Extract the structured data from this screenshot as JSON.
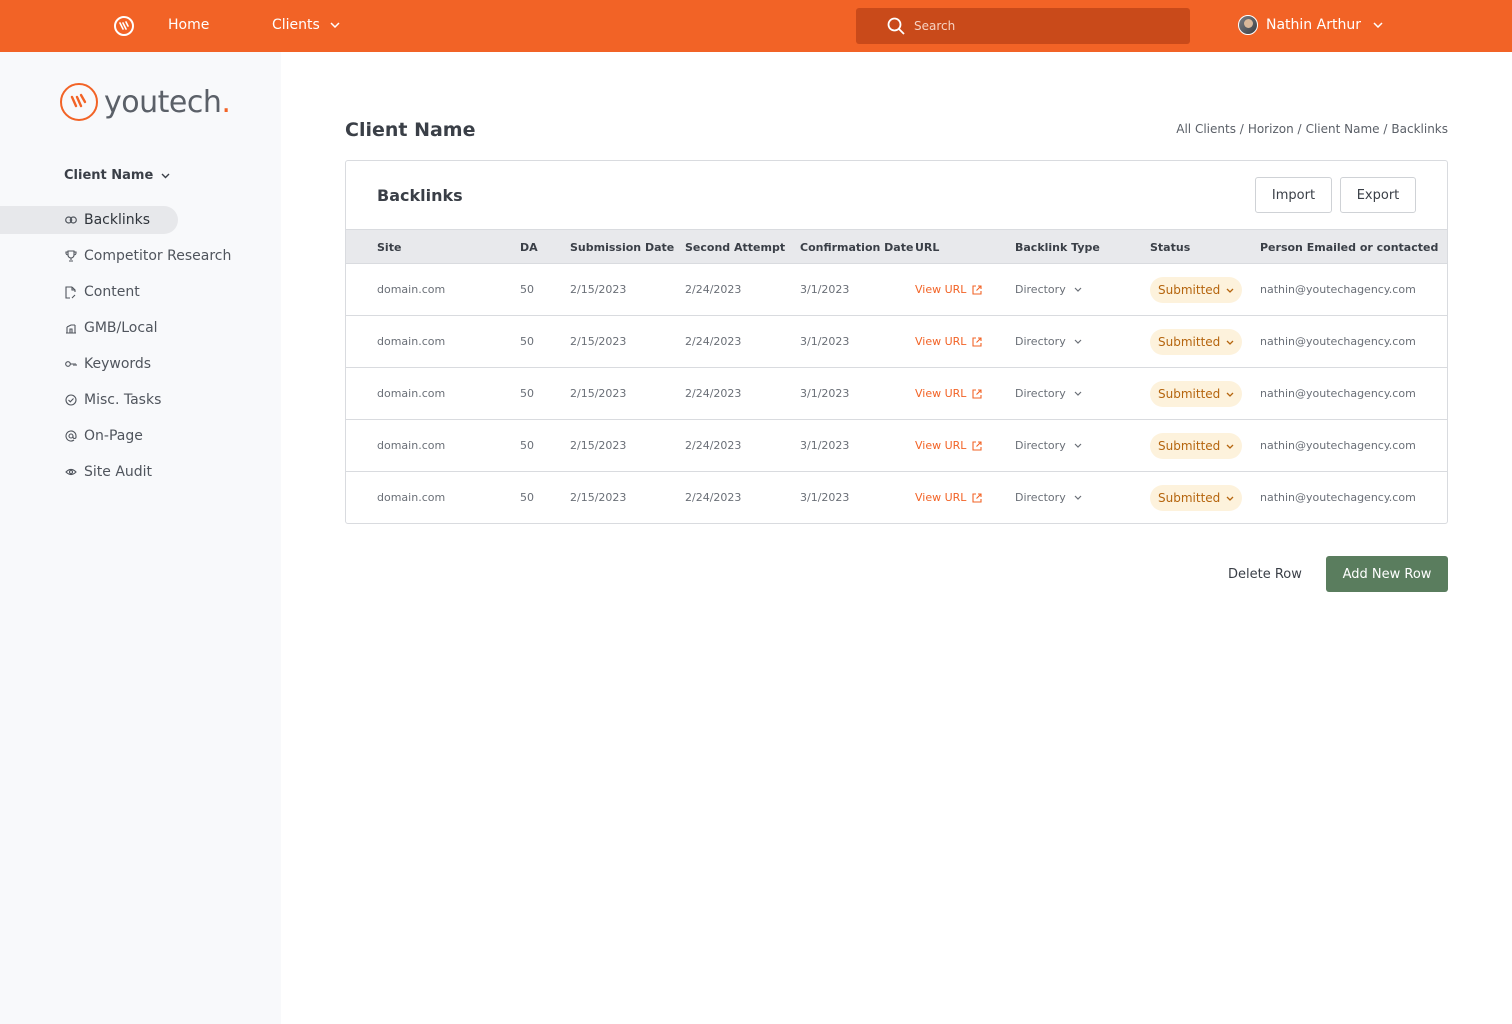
{
  "topbar": {
    "home_label": "Home",
    "clients_label": "Clients",
    "search_placeholder": "Search",
    "user_name": "Nathin Arthur"
  },
  "brand": {
    "name": "youtech",
    "dot": "."
  },
  "sidebar": {
    "client_select": "Client Name",
    "items": [
      {
        "label": "Backlinks",
        "icon": "link-icon",
        "active": true
      },
      {
        "label": "Competitor Research",
        "icon": "trophy-icon"
      },
      {
        "label": "Content",
        "icon": "file-edit-icon"
      },
      {
        "label": "GMB/Local",
        "icon": "store-icon"
      },
      {
        "label": "Keywords",
        "icon": "key-icon"
      },
      {
        "label": "Misc. Tasks",
        "icon": "check-circle-icon"
      },
      {
        "label": "On-Page",
        "icon": "at-sign-icon"
      },
      {
        "label": "Site Audit",
        "icon": "eye-icon"
      }
    ]
  },
  "page": {
    "title": "Client Name",
    "breadcrumb": [
      "All Clients /",
      "Horizon /",
      "Client Name /",
      "Backlinks"
    ]
  },
  "card": {
    "title": "Backlinks",
    "import_label": "Import",
    "export_label": "Export",
    "columns": [
      "Site",
      "DA",
      "Submission Date",
      "Second Attempt",
      "Confirmation Date",
      "URL",
      "Backlink Type",
      "Status",
      "Person Emailed or contacted"
    ],
    "rows": [
      {
        "site": "domain.com",
        "da": "50",
        "submission": "2/15/2023",
        "second": "2/24/2023",
        "confirmation": "3/1/2023",
        "url": "View URL",
        "type": "Directory",
        "status": "Submitted",
        "person": "nathin@youtechagency.com"
      },
      {
        "site": "domain.com",
        "da": "50",
        "submission": "2/15/2023",
        "second": "2/24/2023",
        "confirmation": "3/1/2023",
        "url": "View URL",
        "type": "Directory",
        "status": "Submitted",
        "person": "nathin@youtechagency.com"
      },
      {
        "site": "domain.com",
        "da": "50",
        "submission": "2/15/2023",
        "second": "2/24/2023",
        "confirmation": "3/1/2023",
        "url": "View URL",
        "type": "Directory",
        "status": "Submitted",
        "person": "nathin@youtechagency.com"
      },
      {
        "site": "domain.com",
        "da": "50",
        "submission": "2/15/2023",
        "second": "2/24/2023",
        "confirmation": "3/1/2023",
        "url": "View URL",
        "type": "Directory",
        "status": "Submitted",
        "person": "nathin@youtechagency.com"
      },
      {
        "site": "domain.com",
        "da": "50",
        "submission": "2/15/2023",
        "second": "2/24/2023",
        "confirmation": "3/1/2023",
        "url": "View URL",
        "type": "Directory",
        "status": "Submitted",
        "person": "nathin@youtechagency.com"
      }
    ]
  },
  "actions": {
    "delete_label": "Delete Row",
    "add_label": "Add New Row"
  },
  "colors": {
    "brand_orange": "#f26326",
    "search_bg": "#c94a1a",
    "add_green": "#5a7d5e",
    "status_bg": "#fdf2dc",
    "status_text": "#b5650e"
  }
}
